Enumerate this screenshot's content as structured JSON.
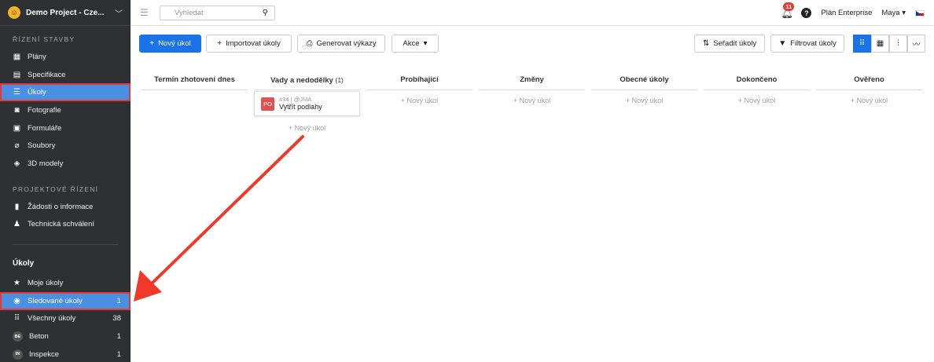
{
  "project": {
    "name": "Demo Project - Cze...",
    "logo_text": "☺"
  },
  "sidebar": {
    "section1_title": "ŘÍZENÍ STAVBY",
    "section1_items": [
      {
        "label": "Plány",
        "icon": "blueprint-icon"
      },
      {
        "label": "Specifikace",
        "icon": "document-stack-icon"
      },
      {
        "label": "Úkoly",
        "icon": "list-icon",
        "active": true
      },
      {
        "label": "Fotografie",
        "icon": "camera-icon"
      },
      {
        "label": "Formuláře",
        "icon": "clipboard-icon"
      },
      {
        "label": "Soubory",
        "icon": "paperclip-icon"
      },
      {
        "label": "3D modely",
        "icon": "cube-icon"
      }
    ],
    "section2_title": "PROJEKTOVÉ ŘÍZENÍ",
    "section2_items": [
      {
        "label": "Žádosti o informace",
        "icon": "info-document-icon"
      },
      {
        "label": "Technická schválení",
        "icon": "stamp-icon"
      }
    ],
    "tasks_title": "Úkoly",
    "task_items": [
      {
        "label": "Moje úkoly",
        "icon": "star-icon",
        "count": ""
      },
      {
        "label": "Sledované úkoly",
        "icon": "eye-icon",
        "count": "1"
      },
      {
        "label": "Všechny úkoly",
        "icon": "grid-icon",
        "count": "38"
      },
      {
        "label": "Beton",
        "badge": "BE",
        "count": "1"
      },
      {
        "label": "Inspekce",
        "badge": "IN",
        "count": "1"
      }
    ]
  },
  "topbar": {
    "search_placeholder": "Vyhledat",
    "notifications": "11",
    "help": "?",
    "plan": "Plán Enterprise",
    "user": "Maya ▾"
  },
  "toolbar": {
    "new_task": "Nový úkol",
    "import_tasks": "Importovat úkoly",
    "generate_reports": "Generovat výkazy",
    "actions": "Akce",
    "sort_tasks": "Seřadit úkoly",
    "filter_tasks": "Filtrovat úkoly"
  },
  "board": {
    "add_label": "+ Nový úkol",
    "columns": [
      {
        "title": "Termín zhotovení dnes",
        "count": ""
      },
      {
        "title": "Vady a nedodělky",
        "count": "(1)"
      },
      {
        "title": "Probíhající",
        "count": ""
      },
      {
        "title": "Změny",
        "count": ""
      },
      {
        "title": "Obecné úkoly",
        "count": ""
      },
      {
        "title": "Dokončeno",
        "count": ""
      },
      {
        "title": "Ověřeno",
        "count": ""
      }
    ],
    "card": {
      "avatar": "PO",
      "meta": "#34 | @JMA",
      "title": "Vytřít podlahy"
    }
  },
  "colors": {
    "accent": "#1a73e8",
    "sidebar_bg": "#2f3033",
    "highlight": "#e53935",
    "active_item": "#4a90e2"
  }
}
